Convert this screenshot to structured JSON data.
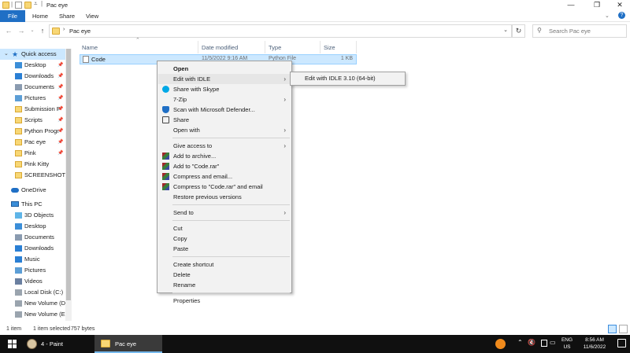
{
  "window": {
    "title": "Pac eye",
    "controls": {
      "minimize": "—",
      "maximize": "❐",
      "close": "✕"
    }
  },
  "ribbon": {
    "tabs": [
      "File",
      "Home",
      "Share",
      "View"
    ]
  },
  "address": {
    "path": "Pac eye",
    "search_placeholder": "Search Pac eye"
  },
  "nav": {
    "quick_access": "Quick access",
    "pinned": [
      {
        "label": "Desktop",
        "icon": "desktop-icon",
        "pinned": true
      },
      {
        "label": "Downloads",
        "icon": "download-icon",
        "pinned": true
      },
      {
        "label": "Documents",
        "icon": "documents-icon",
        "pinned": true
      },
      {
        "label": "Pictures",
        "icon": "pictures-icon",
        "pinned": true
      },
      {
        "label": "Submission P",
        "icon": "folder-icon",
        "pinned": true
      },
      {
        "label": "Scripts",
        "icon": "folder-icon",
        "pinned": true
      },
      {
        "label": "Python Progr",
        "icon": "folder-icon",
        "pinned": true
      },
      {
        "label": "Pac eye",
        "icon": "folder-icon",
        "pinned": true
      },
      {
        "label": "Pink",
        "icon": "folder-icon",
        "pinned": true
      },
      {
        "label": "Pink Kitty",
        "icon": "folder-icon",
        "pinned": false
      },
      {
        "label": "SCREENSHOTS",
        "icon": "folder-icon",
        "pinned": false
      }
    ],
    "onedrive": "OneDrive",
    "this_pc": "This PC",
    "pc_items": [
      {
        "label": "3D Objects",
        "icon": "3d-objects-icon"
      },
      {
        "label": "Desktop",
        "icon": "desktop-icon"
      },
      {
        "label": "Documents",
        "icon": "documents-icon"
      },
      {
        "label": "Downloads",
        "icon": "download-icon"
      },
      {
        "label": "Music",
        "icon": "music-icon"
      },
      {
        "label": "Pictures",
        "icon": "pictures-icon"
      },
      {
        "label": "Videos",
        "icon": "videos-icon"
      },
      {
        "label": "Local Disk (C:)",
        "icon": "disk-icon"
      },
      {
        "label": "New Volume (D:",
        "icon": "disk-icon"
      },
      {
        "label": "New Volume (E:)",
        "icon": "disk-icon"
      }
    ]
  },
  "columns": {
    "name": "Name",
    "date": "Date modified",
    "type": "Type",
    "size": "Size"
  },
  "file": {
    "name": "Code",
    "date": "11/5/2022 9:16 AM",
    "type": "Python File",
    "size": "1 KB"
  },
  "context_menu": {
    "items": [
      {
        "label": "Open",
        "bold": true
      },
      {
        "label": "Edit with IDLE",
        "submenu": true
      },
      {
        "label": "Share with Skype",
        "icon": "skype-icon"
      },
      {
        "label": "7-Zip",
        "submenu": true
      },
      {
        "label": "Scan with Microsoft Defender...",
        "icon": "defender-icon"
      },
      {
        "label": "Share",
        "icon": "share-icon"
      },
      {
        "label": "Open with",
        "submenu": true
      },
      {
        "sep": true
      },
      {
        "label": "Give access to",
        "submenu": true
      },
      {
        "label": "Add to archive...",
        "icon": "winrar-icon"
      },
      {
        "label": "Add to \"Code.rar\"",
        "icon": "winrar-icon"
      },
      {
        "label": "Compress and email...",
        "icon": "winrar-icon"
      },
      {
        "label": "Compress to \"Code.rar\" and email",
        "icon": "winrar-icon"
      },
      {
        "label": "Restore previous versions"
      },
      {
        "sep": true
      },
      {
        "label": "Send to",
        "submenu": true
      },
      {
        "sep": true
      },
      {
        "label": "Cut"
      },
      {
        "label": "Copy"
      },
      {
        "label": "Paste"
      },
      {
        "sep": true
      },
      {
        "label": "Create shortcut"
      },
      {
        "label": "Delete"
      },
      {
        "label": "Rename"
      },
      {
        "sep": true
      },
      {
        "label": "Properties"
      }
    ],
    "submenu_item": "Edit with IDLE 3.10 (64-bit)"
  },
  "status": {
    "count": "1 item",
    "selected": "1 item selected",
    "size": "757 bytes"
  },
  "taskbar": {
    "apps": [
      {
        "label": "4 - Paint",
        "icon": "paint-icon"
      },
      {
        "label": "Pac eye",
        "icon": "folder-icon"
      }
    ],
    "lang": "ENG",
    "region": "US",
    "time": "8:56 AM",
    "date": "11/6/2022"
  },
  "colors": {
    "accent": "#1f6fc5",
    "selection": "#cce8ff",
    "taskbar": "#101010",
    "folder": "#f8d775"
  }
}
